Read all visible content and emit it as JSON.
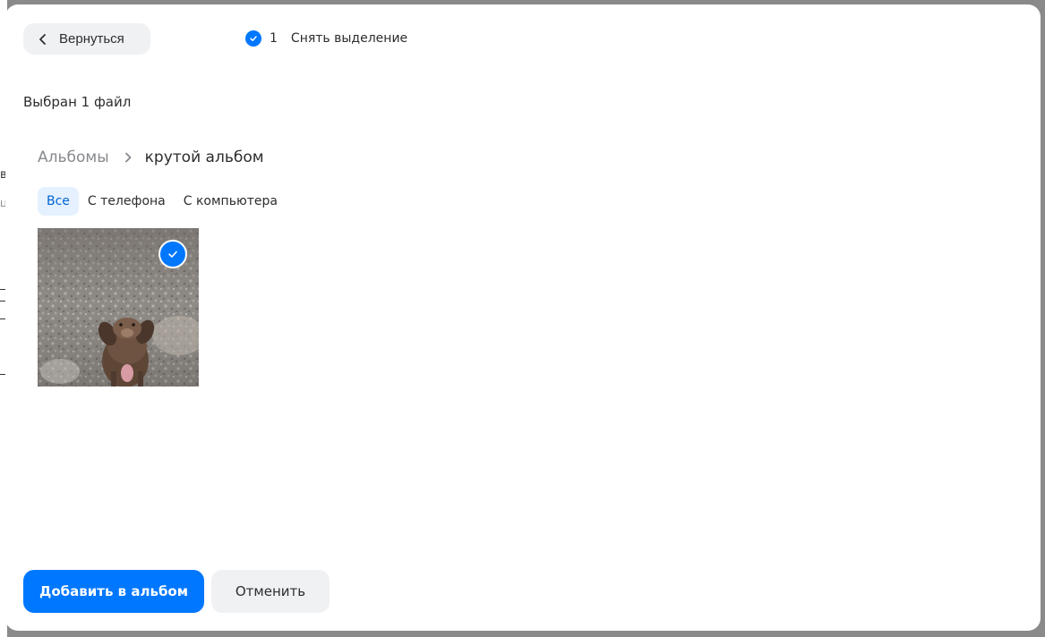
{
  "background": {
    "fragments": [
      "в",
      "ц"
    ]
  },
  "header": {
    "back_label": "Вернуться",
    "selected_count": "1",
    "deselect_label": "Снять выделение"
  },
  "selection": {
    "title": "Выбран 1 файл"
  },
  "breadcrumb": {
    "root": "Альбомы",
    "current": "крутой альбом"
  },
  "filter_tabs": [
    {
      "label": "Все",
      "active": true
    },
    {
      "label": "С телефона",
      "active": false
    },
    {
      "label": "С компьютера",
      "active": false
    }
  ],
  "photos": [
    {
      "subject": "dog on gravel",
      "selected": true
    }
  ],
  "footer": {
    "primary_label": "Добавить в альбом",
    "secondary_label": "Отменить"
  },
  "colors": {
    "accent": "#0077ff",
    "active_tab_bg": "#e5f1ff",
    "secondary_bg": "#f0f1f3"
  }
}
